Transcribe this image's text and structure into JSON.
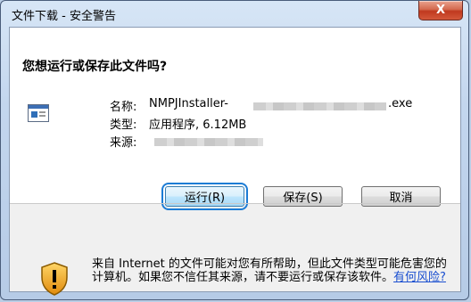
{
  "window": {
    "title": "文件下载 - 安全警告",
    "close_glyph": "X"
  },
  "dialog": {
    "question": "您想运行或保存此文件吗?",
    "file": {
      "name_label": "名称:",
      "name_prefix": "NMPJInstaller-",
      "name_suffix": ".exe",
      "type_label": "类型:",
      "type_value": "应用程序, 6.12MB",
      "from_label": "来源:"
    },
    "buttons": {
      "run": "运行(R)",
      "save": "保存(S)",
      "cancel": "取消"
    },
    "warning": {
      "text": "来自 Internet 的文件可能对您有所帮助，但此文件类型可能危害您的计算机。如果您不信任其来源，请不要运行或保存该软件。",
      "link": "有何风险?"
    }
  },
  "colors": {
    "accent": "#1c7cd5",
    "link": "#1a4fd0",
    "shield": "#f5a623"
  },
  "icons": [
    "close-icon",
    "application-file-icon",
    "security-shield-icon"
  ]
}
